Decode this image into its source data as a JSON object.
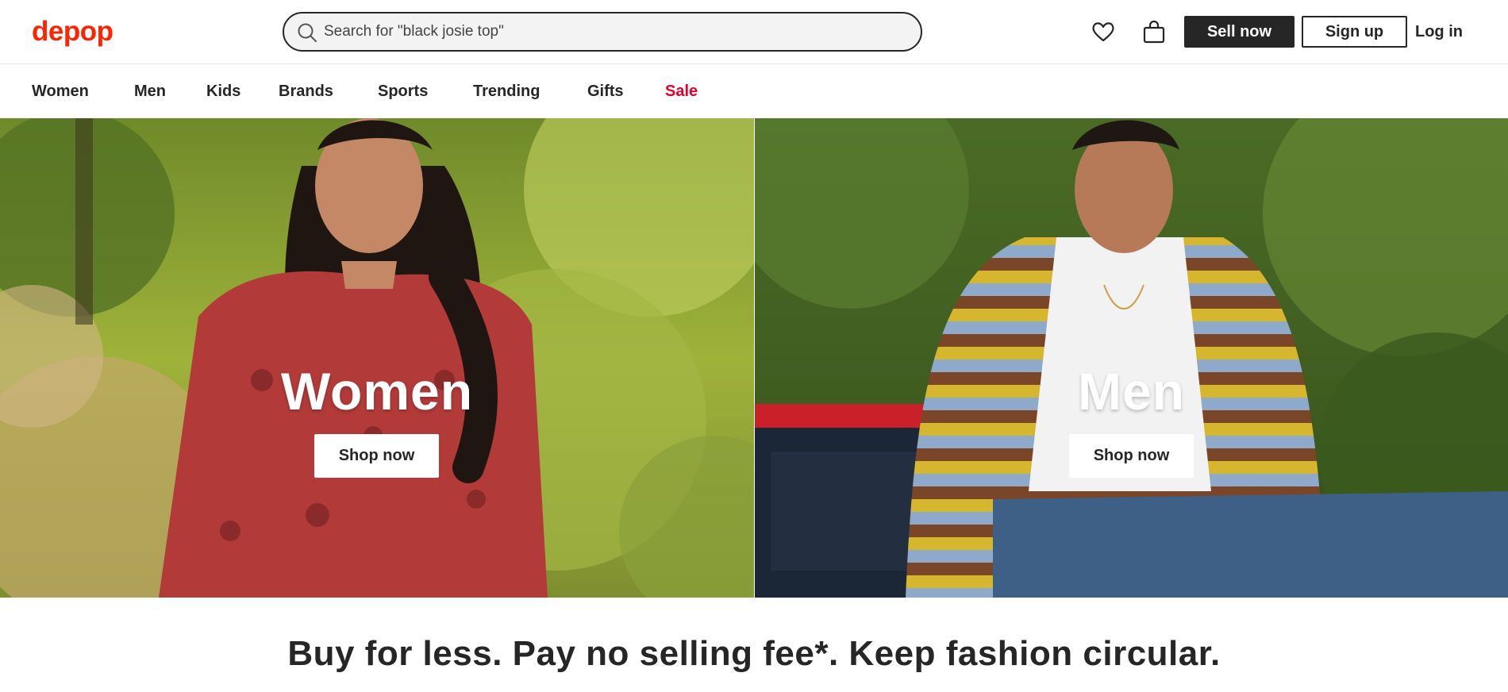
{
  "header": {
    "logo": "depop",
    "search": {
      "placeholder": "Search for \"black josie top\""
    },
    "sell_label": "Sell now",
    "signup_label": "Sign up",
    "login_label": "Log in",
    "icons": [
      "search-icon",
      "heart-icon",
      "bag-icon"
    ]
  },
  "nav": {
    "items": [
      {
        "label": "Women"
      },
      {
        "label": "Men"
      },
      {
        "label": "Kids"
      },
      {
        "label": "Brands"
      },
      {
        "label": "Sports"
      },
      {
        "label": "Trending"
      },
      {
        "label": "Gifts"
      },
      {
        "label": "Sale"
      }
    ],
    "sale_color": "#e4002b"
  },
  "hero": {
    "left": {
      "title": "Women",
      "button": "Shop now"
    },
    "right": {
      "title": "Men",
      "button": "Shop now"
    }
  },
  "tagline": "Buy for less. Pay no selling fee*. Keep fashion circular.",
  "colors": {
    "brand": "#ff2300",
    "dark": "#262626"
  }
}
